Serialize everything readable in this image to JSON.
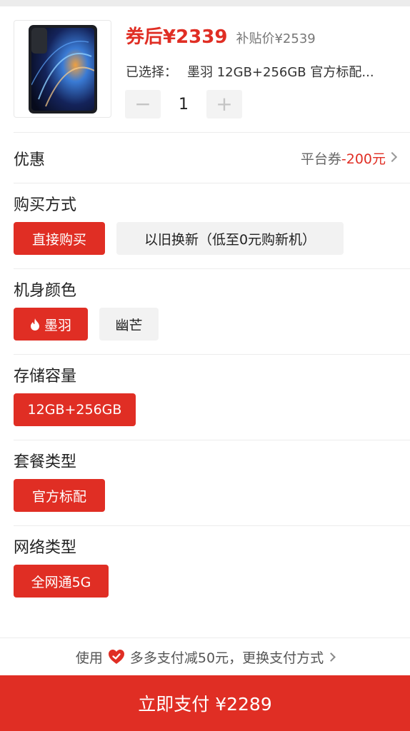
{
  "product": {
    "price_after_coupon": "券后¥2339",
    "subsidy_price": "补贴价¥2539",
    "selected_label": "已选择：",
    "selected_value": "墨羽 12GB+256GB 官方标配...",
    "quantity": "1",
    "qty_minus": "−",
    "qty_plus": "+"
  },
  "coupon": {
    "title": "优惠",
    "value_prefix": "平台券",
    "value_amount": "-200元"
  },
  "sections": {
    "purchase": {
      "title": "购买方式",
      "options": [
        "直接购买",
        "以旧换新（低至0元购新机）"
      ],
      "selected": "直接购买"
    },
    "color": {
      "title": "机身颜色",
      "options": [
        "墨羽",
        "幽芒"
      ],
      "selected": "墨羽"
    },
    "storage": {
      "title": "存储容量",
      "options": [
        "12GB+256GB"
      ],
      "selected": "12GB+256GB"
    },
    "package": {
      "title": "套餐类型",
      "options": [
        "官方标配"
      ],
      "selected": "官方标配"
    },
    "network": {
      "title": "网络类型",
      "options": [
        "全网通5G"
      ],
      "selected": "全网通5G"
    }
  },
  "payment": {
    "use_label": "使用",
    "method_text": "多多支付减50元，更换支付方式",
    "pay_button": "立即支付 ¥2289"
  },
  "colors": {
    "accent": "#e02e24",
    "chip_inactive_bg": "#f2f2f2",
    "divider": "#ececec"
  },
  "icons": {
    "flame": "flame-icon",
    "heart": "heart-check-icon",
    "chevron": "chevron-right-icon"
  }
}
